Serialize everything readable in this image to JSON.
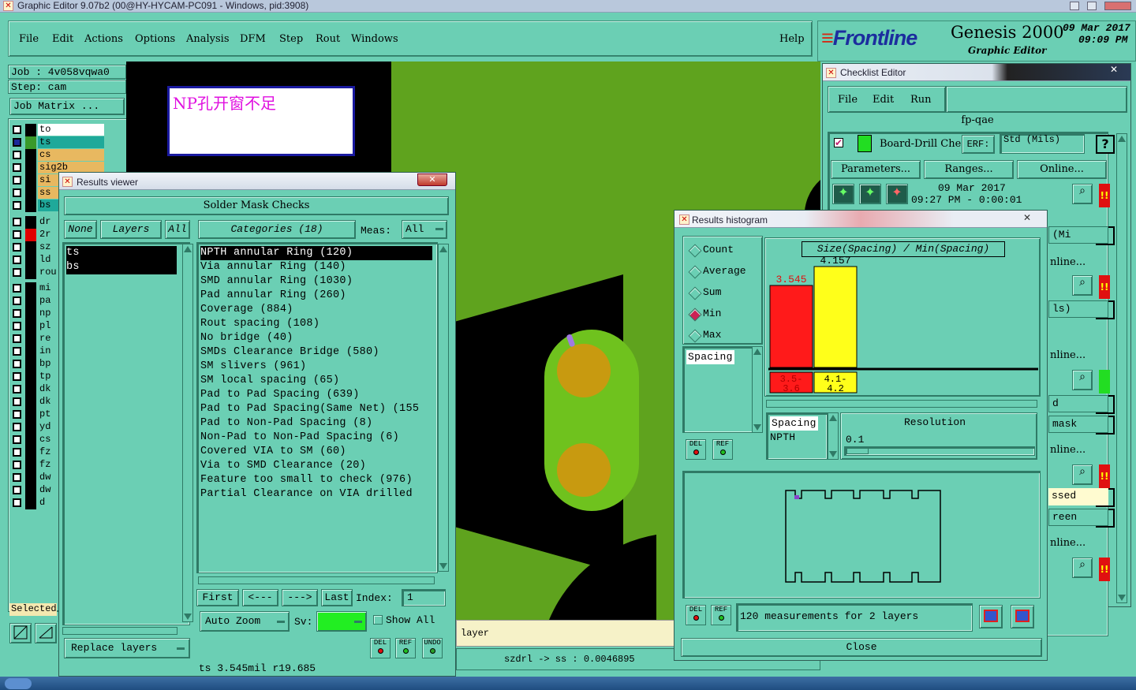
{
  "os_window": {
    "title": "Graphic Editor 9.07b2 (00@HY-HYCAM-PC091 - Windows, pid:3908)"
  },
  "menu": {
    "items": [
      "File",
      "Edit",
      "Actions",
      "Options",
      "Analysis",
      "DFM",
      "Step",
      "Rout",
      "Windows"
    ],
    "help": "Help"
  },
  "header": {
    "logo": "Frontline",
    "product": "Genesis 2000",
    "subtitle": "Graphic Editor",
    "date": "09 Mar 2017",
    "time": "09:09 PM"
  },
  "job": {
    "job_label": "Job : 4v058vqwa0",
    "step_label": "Step: cam",
    "matrix_button": "Job Matrix ..."
  },
  "layers": {
    "group1": [
      {
        "name": "to",
        "color": "#000000",
        "bg": "#ffffff"
      },
      {
        "name": "ts",
        "color": "#3a9a2a",
        "bg": "#1fa99a"
      },
      {
        "name": "cs",
        "color": "#000000",
        "bg": "#e8b860"
      },
      {
        "name": "sig2b",
        "color": "#000000",
        "bg": "#e8b860"
      },
      {
        "name": "si",
        "color": "#000000",
        "bg": "#e8b860"
      },
      {
        "name": "ss",
        "color": "#000000",
        "bg": "#e8b860"
      },
      {
        "name": "bs",
        "color": "#000000",
        "bg": "#1fa99a"
      }
    ],
    "group2": [
      {
        "name": "dr",
        "color": "#000000"
      },
      {
        "name": "2r",
        "color": "#e00000"
      },
      {
        "name": "sz",
        "color": "#000000"
      },
      {
        "name": "ld",
        "color": "#000000"
      },
      {
        "name": "rou",
        "color": "#000000"
      }
    ],
    "group3": [
      "mi",
      "pa",
      "np",
      "pl",
      "re",
      "in",
      "bp",
      "tp",
      "dk",
      "dk",
      "pt",
      "yd",
      "cs",
      "fz",
      "fz",
      "dw",
      "dw",
      "d"
    ],
    "selected_label": "Selected"
  },
  "canvas": {
    "note": "NP孔开窗不足",
    "layer_label": "layer",
    "status": "szdrl -> ss : 0.0046895"
  },
  "results_viewer": {
    "title": "Results viewer",
    "header": "Solder Mask Checks",
    "none_btn": "None",
    "layers_btn": "Layers",
    "all_btn": "All",
    "categories_label": "Categories (18)",
    "meas_label": "Meas:",
    "meas_value": "All",
    "layer_list": [
      "ts",
      "bs"
    ],
    "categories": [
      "NPTH annular Ring (120)",
      "Via annular Ring (140)",
      "SMD annular Ring (1030)",
      "Pad annular Ring (260)",
      "Coverage (884)",
      "Rout spacing (108)",
      "No bridge (40)",
      "SMDs Clearance Bridge (580)",
      "SM slivers (961)",
      "SM local spacing (65)",
      "Pad to Pad Spacing (639)",
      "Pad to Pad Spacing(Same Net) (155",
      "Pad to Non-Pad Spacing (8)",
      "Non-Pad to Non-Pad Spacing (6)",
      "Covered VIA to SM (60)",
      "Via to SMD Clearance (20)",
      "Feature too small to check (976)",
      "Partial Clearance on VIA drilled"
    ],
    "nav": {
      "first": "First",
      "prev": "<---",
      "next": "--->",
      "last": "Last",
      "index_label": "Index:",
      "index_value": "1"
    },
    "auto_zoom": "Auto Zoom",
    "sv_label": "Sv:",
    "show_all": "Show All",
    "replace_layers": "Replace layers",
    "icons": {
      "del": "DEL",
      "ref": "REF",
      "undo": "UNDO"
    },
    "status": "ts 3.545mil  r19.685"
  },
  "checklist_editor": {
    "title": "Checklist Editor",
    "menu": [
      "File",
      "Edit",
      "Run"
    ],
    "name": "fp-qae",
    "action": "Board-Drill Che",
    "erf_label": "ERF:",
    "erf_value": "Std (Mils)",
    "parameters": "Parameters...",
    "ranges": "Ranges...",
    "online": "Online...",
    "date": "09 Mar 2017",
    "time": "09:27 PM - 0:00:01",
    "partial_rows": [
      "(Mi",
      "nline...",
      "ls)",
      "nline...",
      "d",
      "mask",
      "nline...",
      "ssed",
      "reen",
      "nline..."
    ]
  },
  "histogram": {
    "title": "Results histogram",
    "modes": [
      "Count",
      "Average",
      "Sum",
      "Min",
      "Max"
    ],
    "selected_mode": "Min",
    "measure_list": [
      "Spacing"
    ],
    "chart_title": "Size(Spacing) / Min(Spacing)",
    "legend_types": [
      "Spacing",
      "NPTH"
    ],
    "resolution_label": "Resolution",
    "resolution_value": "0.1",
    "summary": "120 measurements for 2 layers",
    "close": "Close",
    "icons": {
      "del": "DEL",
      "ref": "REF"
    }
  },
  "chart_data": {
    "type": "bar",
    "title": "Size(Spacing) / Min(Spacing)",
    "categories": [
      "3.5-3.6",
      "4.1-4.2"
    ],
    "values": [
      3.545,
      4.157
    ],
    "colors": [
      "#ff1a1a",
      "#ffff1a"
    ],
    "ylim": [
      0,
      4.5
    ]
  },
  "colors": {
    "ui_bg": "#6bcfb4",
    "board_green": "#5fa31e",
    "pad_gold": "#c89a10",
    "logo_red": "#d42a16",
    "logo_blue": "#1c2d9e"
  }
}
